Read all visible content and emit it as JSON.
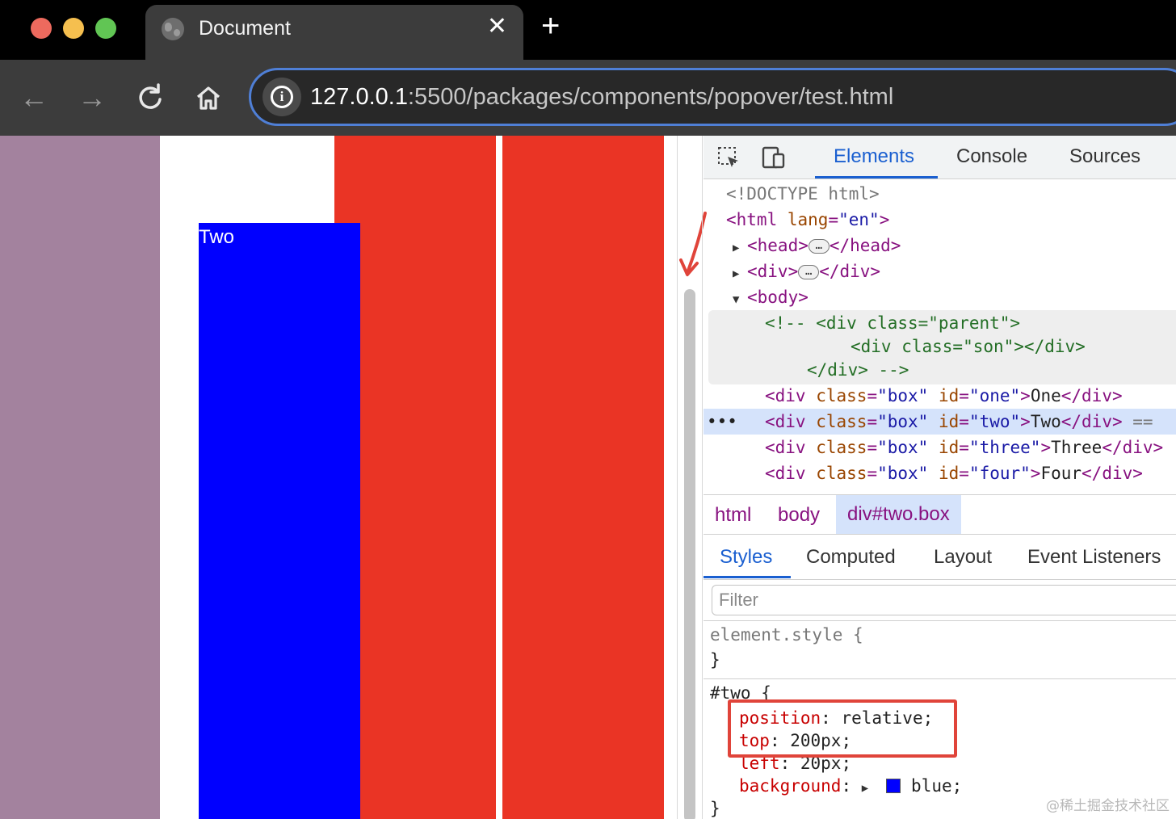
{
  "browser": {
    "tab_title": "Document",
    "tab_close": "✕",
    "new_tab": "+",
    "url_host": "127.0.0.1",
    "url_path": ":5500/packages/components/popover/test.html",
    "nav": {
      "back": "←",
      "forward": "→",
      "reload": "↻",
      "home": "⌂"
    }
  },
  "page": {
    "box_two_label": "Two",
    "colors": {
      "purple": "#a3829e",
      "red": "#ea3425",
      "blue": "#0000ff"
    }
  },
  "devtools": {
    "tabs": [
      "Elements",
      "Console",
      "Sources"
    ],
    "active_tab": "Elements",
    "dom": {
      "doctype": "<!DOCTYPE html>",
      "html_open": "<html",
      "html_attr": "lang",
      "html_val": "\"en\"",
      "head": "<head>",
      "head_close": "</head>",
      "div": "<div>",
      "div_close": "</div>",
      "body": "<body>",
      "comment_1": "<!-- <div class=\"parent\">",
      "comment_2": "<div class=\"son\"></div>",
      "comment_3": "</div> -->",
      "ellipsis": "…",
      "row_marker": "•••",
      "eq_marker": "==",
      "boxes": [
        {
          "id": "\"one\"",
          "text": "One"
        },
        {
          "id": "\"two\"",
          "text": "Two"
        },
        {
          "id": "\"three\"",
          "text": "Three"
        },
        {
          "id": "\"four\"",
          "text": "Four"
        }
      ],
      "div_tag": "<div",
      "class_attr": "class",
      "class_val": "\"box\"",
      "id_attr": "id",
      "close_tag": "</div>"
    },
    "breadcrumb": [
      "html",
      "body",
      "div#two.box"
    ],
    "styles_tabs": [
      "Styles",
      "Computed",
      "Layout",
      "Event Listeners"
    ],
    "filter_placeholder": "Filter",
    "rules": {
      "element_style": "element.style {",
      "close_brace": "}",
      "two_selector": "#two {",
      "props": [
        {
          "name": "position",
          "value": "relative;"
        },
        {
          "name": "top",
          "value": "200px;"
        },
        {
          "name": "left",
          "value": "20px;"
        },
        {
          "name": "background",
          "value": "blue;"
        }
      ]
    }
  },
  "watermark": "@稀土掘金技术社区"
}
